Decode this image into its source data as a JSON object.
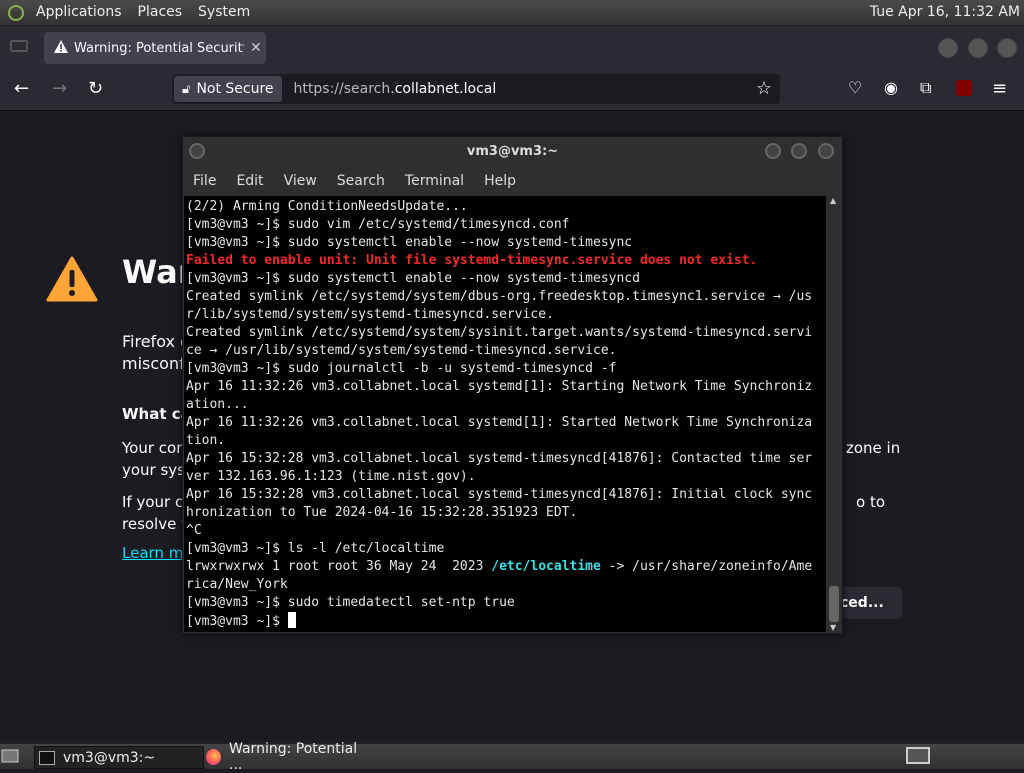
{
  "top_panel": {
    "menus": [
      "Applications",
      "Places",
      "System"
    ],
    "clock": "Tue Apr 16, 11:32 AM"
  },
  "firefox": {
    "tab_title": "Warning: Potential Security Risk Ahead",
    "security_label": "Not Secure",
    "url_prefix": "https://search.",
    "url_domain": "collabnet.local",
    "page": {
      "heading": "War",
      "p1_line1": "Firefox d",
      "p1_line2": "misconf",
      "what_can": "What can",
      "p2_line1": "Your com",
      "p2_line1_right": "zone in",
      "p2_line2": "your syst",
      "p3_line1": "If your clo",
      "p3_line1_right": "o to",
      "p3_line2": "resolve th",
      "learn_more": "Learn mo",
      "advanced_button": "ced..."
    }
  },
  "terminal": {
    "title": "vm3@vm3:~",
    "menu": [
      "File",
      "Edit",
      "View",
      "Search",
      "Terminal",
      "Help"
    ],
    "lines": [
      {
        "text": "(2/2) Arming ConditionNeedsUpdate..."
      },
      {
        "text": "[vm3@vm3 ~]$ sudo vim /etc/systemd/timesyncd.conf"
      },
      {
        "text": "[vm3@vm3 ~]$ sudo systemctl enable --now systemd-timesync"
      },
      {
        "text": "Failed to enable unit: Unit file systemd-timesync.service does not exist.",
        "style": "err"
      },
      {
        "text": "[vm3@vm3 ~]$ sudo systemctl enable --now systemd-timesyncd"
      },
      {
        "text": "Created symlink /etc/systemd/system/dbus-org.freedesktop.timesync1.service → /us"
      },
      {
        "text": "r/lib/systemd/system/systemd-timesyncd.service."
      },
      {
        "text": "Created symlink /etc/systemd/system/sysinit.target.wants/systemd-timesyncd.servi"
      },
      {
        "text": "ce → /usr/lib/systemd/system/systemd-timesyncd.service."
      },
      {
        "text": "[vm3@vm3 ~]$ sudo journalctl -b -u systemd-timesyncd -f"
      },
      {
        "text": "Apr 16 11:32:26 vm3.collabnet.local systemd[1]: Starting Network Time Synchroniz"
      },
      {
        "text": "ation..."
      },
      {
        "text": "Apr 16 11:32:26 vm3.collabnet.local systemd[1]: Started Network Time Synchroniza"
      },
      {
        "text": "tion."
      },
      {
        "text": "Apr 16 15:32:28 vm3.collabnet.local systemd-timesyncd[41876]: Contacted time ser"
      },
      {
        "text": "ver 132.163.96.1:123 (time.nist.gov)."
      },
      {
        "text": "Apr 16 15:32:28 vm3.collabnet.local systemd-timesyncd[41876]: Initial clock sync"
      },
      {
        "text": "hronization to Tue 2024-04-16 15:32:28.351923 EDT."
      },
      {
        "text": "^C"
      },
      {
        "text": "[vm3@vm3 ~]$ ls -l /etc/localtime"
      },
      {
        "parts": [
          {
            "text": "lrwxrwxrwx 1 root root 36 May 24  2023 "
          },
          {
            "text": "/etc/localtime",
            "style": "link"
          },
          {
            "text": " -> /usr/share/zoneinfo/Ame"
          }
        ]
      },
      {
        "text": "rica/New_York"
      },
      {
        "text": "[vm3@vm3 ~]$ sudo timedatectl set-ntp true"
      },
      {
        "text": "[vm3@vm3 ~]$ ",
        "cursor": true
      }
    ]
  },
  "taskbar": {
    "terminal_task": "vm3@vm3:~",
    "firefox_task": "Warning: Potential ..."
  }
}
